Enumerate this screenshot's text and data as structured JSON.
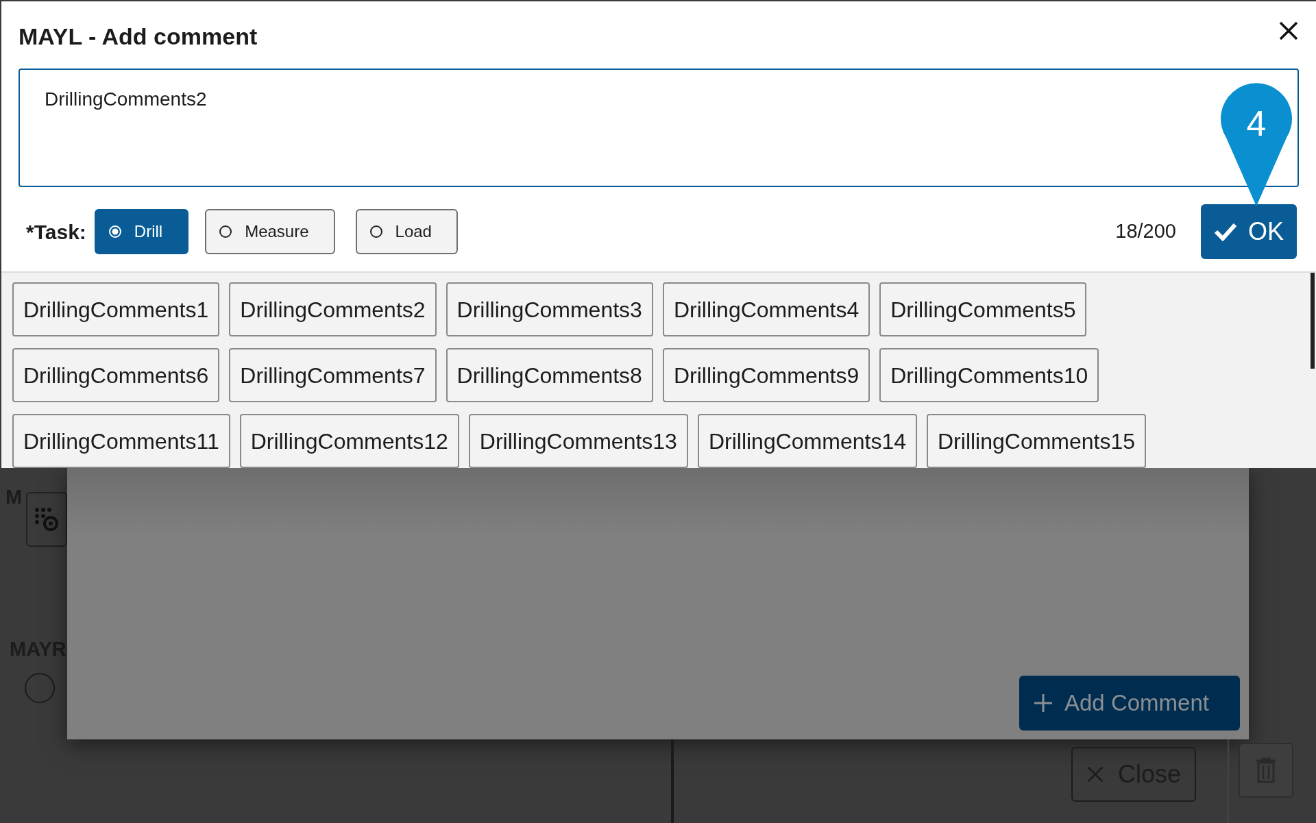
{
  "background": {
    "labels": [
      "M",
      "MAYR"
    ],
    "radio": {
      "checked": false
    },
    "add_comment_button": "Add Comment",
    "close_button": "Close"
  },
  "dialog": {
    "title": "MAYL - Add comment",
    "comment": "DrillingComments2",
    "task_label": "*Task:",
    "tasks": [
      {
        "label": "Drill",
        "selected": true
      },
      {
        "label": "Measure",
        "selected": false
      },
      {
        "label": "Load",
        "selected": false
      }
    ],
    "counter": "18/200",
    "ok_button": "OK",
    "step_marker": "4",
    "quick_comments": [
      [
        "DrillingComments1",
        "DrillingComments2",
        "DrillingComments3",
        "DrillingComments4",
        "DrillingComments5"
      ],
      [
        "DrillingComments6",
        "DrillingComments7",
        "DrillingComments8",
        "DrillingComments9",
        "DrillingComments10"
      ],
      [
        "DrillingComments11",
        "DrillingComments12",
        "DrillingComments13",
        "DrillingComments14",
        "DrillingComments15"
      ]
    ]
  }
}
